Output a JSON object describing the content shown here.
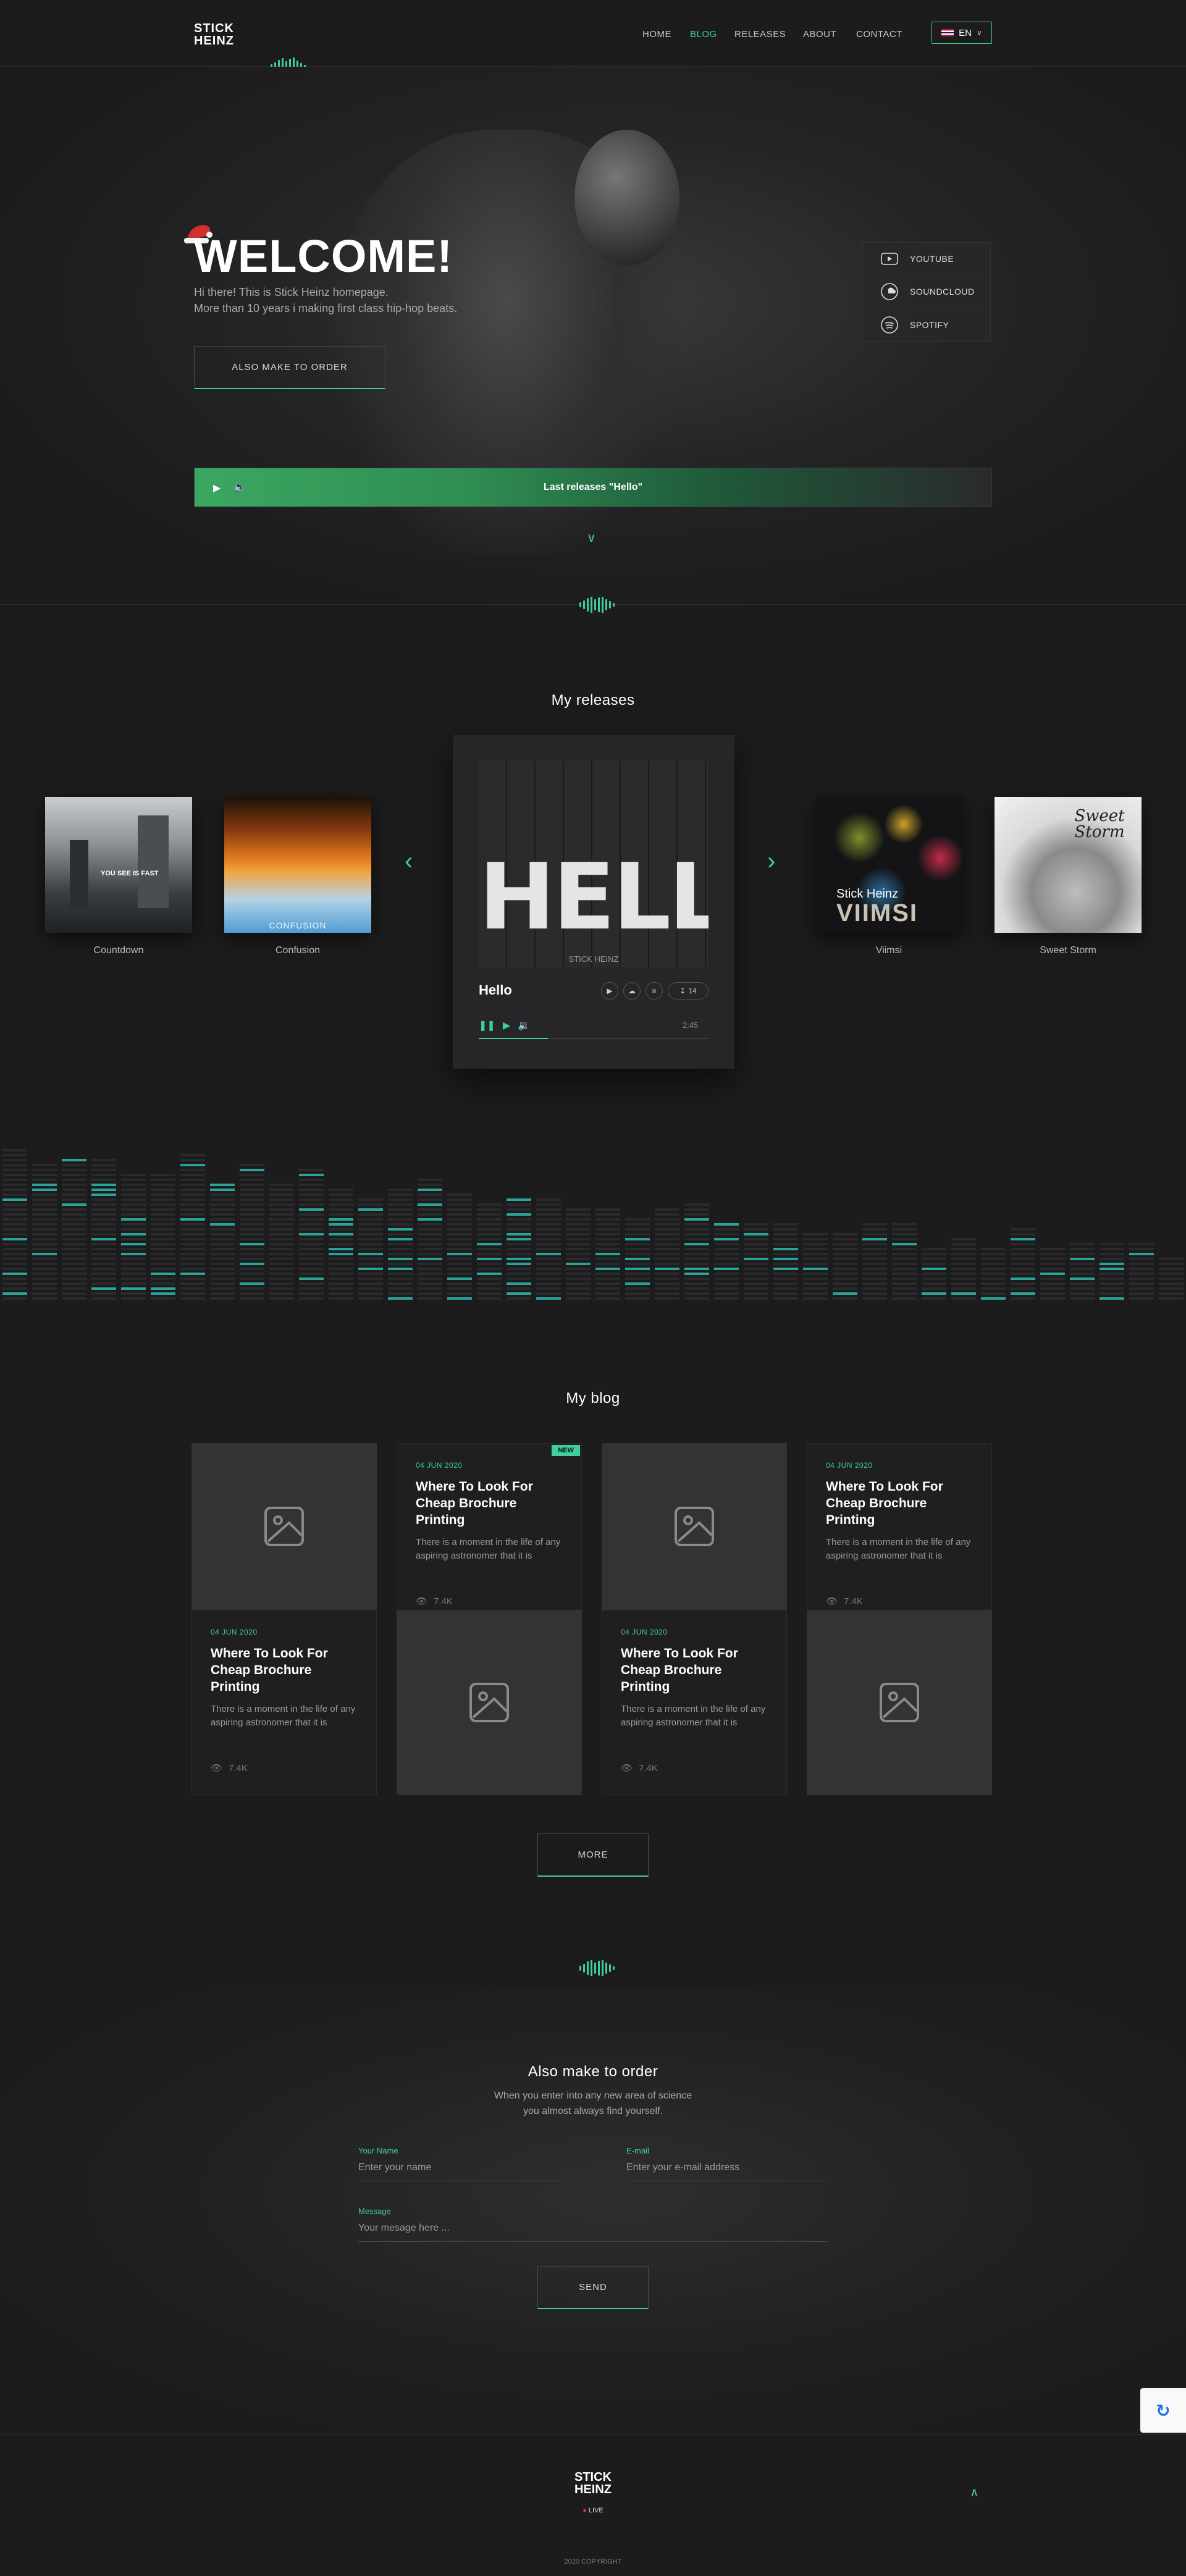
{
  "header": {
    "logo_line1": "STICK",
    "logo_line2": "HEINZ",
    "nav": [
      {
        "label": "HOME",
        "active": false
      },
      {
        "label": "BLOG",
        "active": true
      },
      {
        "label": "RELEASES",
        "active": false
      },
      {
        "label": "ABOUT",
        "active": false
      },
      {
        "label": "CONTACT",
        "active": false
      }
    ],
    "lang": "EN"
  },
  "hero": {
    "title": "WELCOME!",
    "subtitle_line1": "Hi there! This is Stick Heinz homepage.",
    "subtitle_line2": "More than 10 years i making first class hip-hop beats.",
    "cta": "ALSO MAKE TO ORDER",
    "social": [
      {
        "label": "YOUTUBE",
        "icon": "youtube-icon"
      },
      {
        "label": "SOUNDCLOUD",
        "icon": "soundcloud-icon"
      },
      {
        "label": "SPOTIFY",
        "icon": "spotify-icon"
      }
    ],
    "player_text": "Last releases \"Hello\""
  },
  "releases": {
    "title": "My releases",
    "items": [
      {
        "title": "Countdown"
      },
      {
        "title": "Confusion"
      },
      {
        "title": "Viimsi"
      },
      {
        "title": "Sweet Storm"
      }
    ],
    "featured": {
      "title": "Hello",
      "cover_text": "HELLO",
      "cover_sub": "STICK HEINZ",
      "downloads": "14",
      "time": "2:45",
      "progress": 0.3
    },
    "cover_texts": {
      "countdown": "YOU SEE IS FAST",
      "confusion": "CONFUSION",
      "viimsi_artist": "Stick Heinz",
      "viimsi_title": "VIIMSI",
      "sweet_storm": "Sweet Storm"
    }
  },
  "blog": {
    "title": "My blog",
    "posts": [
      {
        "date": "04 JUN 2020",
        "title": "Where To Look For Cheap Brochure Printing",
        "excerpt": "There is a moment in the life of any aspiring astronomer that it is",
        "views": "7.4K",
        "new": false
      },
      {
        "date": "04 JUN 2020",
        "title": "Where To Look For Cheap Brochure Printing",
        "excerpt": "There is a moment in the life of any aspiring astronomer that it is",
        "views": "7.4K",
        "new": true,
        "badge": "NEW"
      },
      {
        "date": "04 JUN 2020",
        "title": "Where To Look For Cheap Brochure Printing",
        "excerpt": "There is a moment in the life of any aspiring astronomer that it is",
        "views": "7.4K",
        "new": false
      },
      {
        "date": "04 JUN 2020",
        "title": "Where To Look For Cheap Brochure Printing",
        "excerpt": "There is a moment in the life of any aspiring astronomer that it is",
        "views": "7.4K",
        "new": false
      }
    ],
    "more": "MORE"
  },
  "contact": {
    "title": "Also make to order",
    "sub_line1": "When you enter into any new area of science",
    "sub_line2": "you almost always find yourself.",
    "name_label": "Your Name",
    "name_placeholder": "Enter your name",
    "email_label": "E-mail",
    "email_placeholder": "Enter your e-mail address",
    "message_label": "Message",
    "message_placeholder": "Your mesage here ...",
    "send": "SEND"
  },
  "footer": {
    "logo_line1": "STICK",
    "logo_line2": "HEINZ",
    "live": "LIVE",
    "copyright": "2020 COPYRIGHT"
  },
  "colors": {
    "accent": "#3fcf9a",
    "background": "#1c1c1d"
  }
}
